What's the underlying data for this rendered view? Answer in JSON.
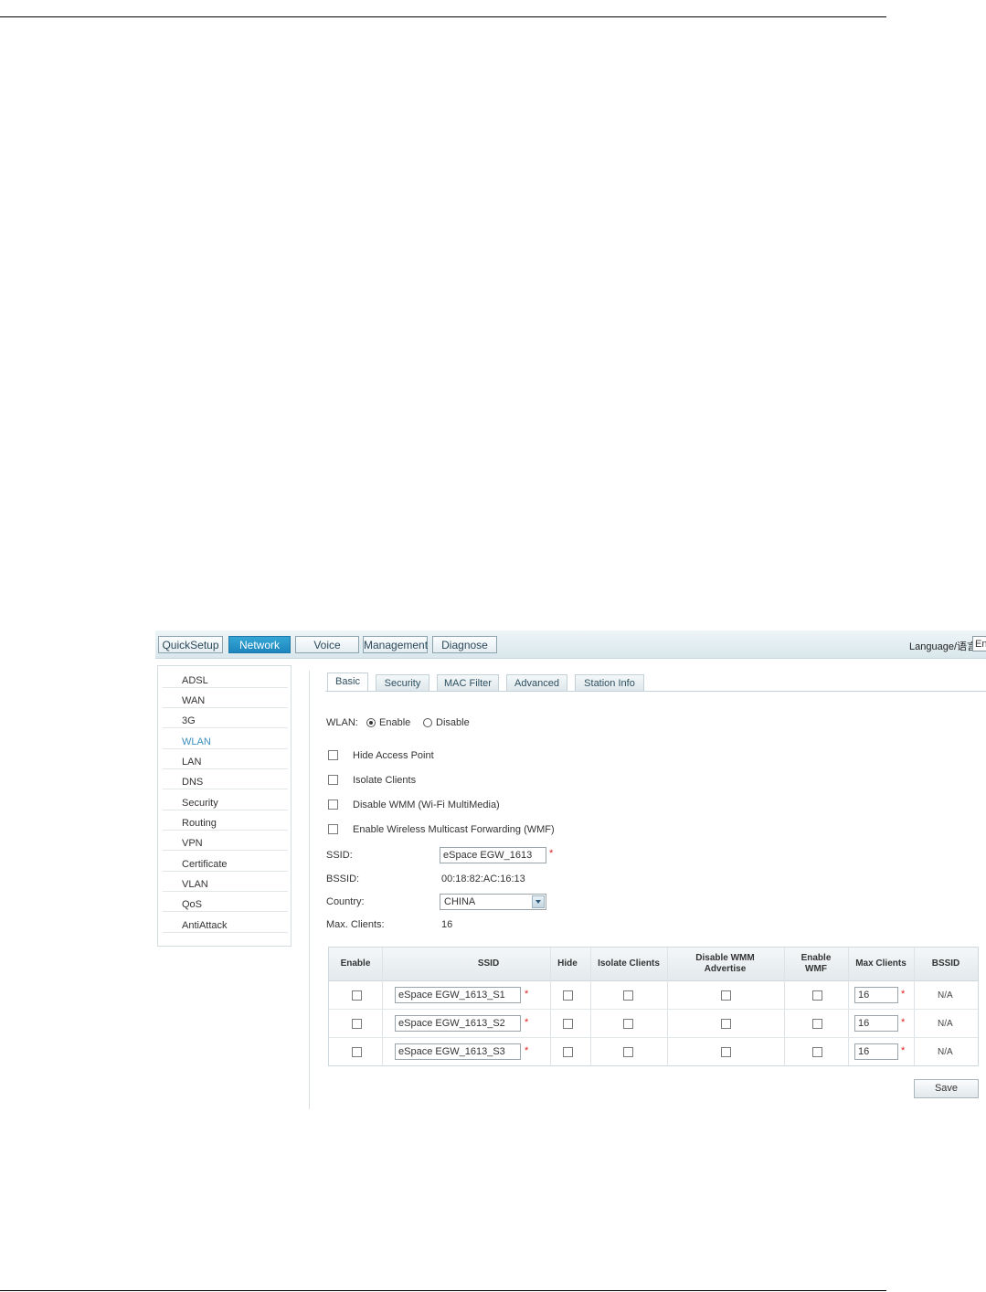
{
  "topnav": {
    "tabs": [
      {
        "label": "QuickSetup"
      },
      {
        "label": "Network"
      },
      {
        "label": "Voice"
      },
      {
        "label": "Management"
      },
      {
        "label": "Diagnose"
      }
    ],
    "active_tab": "Network",
    "language_label": "Language/语言:",
    "language_value": "En"
  },
  "sidebar": {
    "items": [
      "ADSL",
      "WAN",
      "3G",
      "WLAN",
      "LAN",
      "DNS",
      "Security",
      "Routing",
      "VPN",
      "Certificate",
      "VLAN",
      "QoS",
      "AntiAttack"
    ],
    "active_item": "WLAN"
  },
  "subtabs": [
    "Basic",
    "Security",
    "MAC Filter",
    "Advanced",
    "Station Info"
  ],
  "active_subtab": "Basic",
  "form": {
    "wlan_label": "WLAN:",
    "enable_label": "Enable",
    "disable_label": "Disable",
    "wlan_state": "Enable",
    "options": [
      {
        "label": "Hide Access Point",
        "checked": false
      },
      {
        "label": "Isolate Clients",
        "checked": false
      },
      {
        "label": "Disable WMM (Wi-Fi MultiMedia)",
        "checked": false
      },
      {
        "label": "Enable Wireless Multicast Forwarding (WMF)",
        "checked": false
      }
    ],
    "ssid_label": "SSID:",
    "ssid_value": "eSpace EGW_1613",
    "bssid_label": "BSSID:",
    "bssid_value": "00:18:82:AC:16:13",
    "country_label": "Country:",
    "country_value": "CHINA",
    "max_clients_label": "Max. Clients:",
    "max_clients_value": "16",
    "required_mark": "*"
  },
  "table": {
    "headers": {
      "enable": "Enable",
      "ssid": "SSID",
      "hide": "Hide",
      "isolate": "Isolate Clients",
      "disable_wmm_1": "Disable WMM",
      "disable_wmm_2": "Advertise",
      "enable_wmf_1": "Enable",
      "enable_wmf_2": "WMF",
      "max_clients": "Max Clients",
      "bssid": "BSSID"
    },
    "rows": [
      {
        "ssid": "eSpace EGW_1613_S1",
        "max_clients": "16",
        "bssid": "N/A"
      },
      {
        "ssid": "eSpace EGW_1613_S2",
        "max_clients": "16",
        "bssid": "N/A"
      },
      {
        "ssid": "eSpace EGW_1613_S3",
        "max_clients": "16",
        "bssid": "N/A"
      }
    ]
  },
  "save_label": "Save"
}
